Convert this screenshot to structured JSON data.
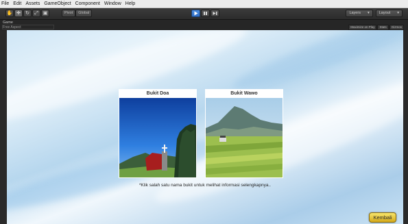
{
  "menu": [
    "File",
    "Edit",
    "Assets",
    "GameObject",
    "Component",
    "Window",
    "Help"
  ],
  "toolbar": {
    "tools": [
      "✋",
      "✛",
      "↻",
      "⤢",
      "▣"
    ],
    "pivot_label": "Pivot",
    "global_label": "Global",
    "layers_label": "Layers",
    "layout_label": "Layout",
    "dropdown_arrow": "▾"
  },
  "game_panel": {
    "tab_label": "Game",
    "aspect_label": "Free Aspect",
    "maximize_label": "Maximize on Play",
    "stats_label": "Stats",
    "gizmos_label": "Gizmos"
  },
  "cards": [
    {
      "title": "Bukit Doa"
    },
    {
      "title": "Bukit Wawo"
    }
  ],
  "hint_text": "*Klik salah satu nama bukit untuk melihat informasi selengkapnya..",
  "back_button": "Kembali",
  "colors": {
    "accent_blue": "#3f7fd6",
    "button_gold": "#e6c53a"
  }
}
